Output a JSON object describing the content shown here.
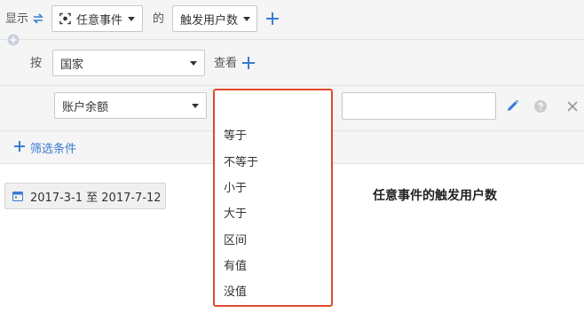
{
  "header": {
    "show_label": "显示",
    "event_select": "任意事件",
    "of_label": "的",
    "metric_select": "触发用户数"
  },
  "group_by": {
    "by_label": "按",
    "dimension_select": "国家",
    "view_label": "查看"
  },
  "filter": {
    "property_select": "账户余额",
    "operator_select": "等于",
    "value_input": "",
    "add_filter_label": "筛选条件",
    "operator_options": [
      "等于",
      "不等于",
      "小于",
      "大于",
      "区间",
      "有值",
      "没值"
    ]
  },
  "date_range": "2017-3-1 至 2017-7-12",
  "chart_title": "任意事件的触发用户数",
  "colors": {
    "accent": "#3a7bd5",
    "highlight_border": "#e0492c"
  }
}
